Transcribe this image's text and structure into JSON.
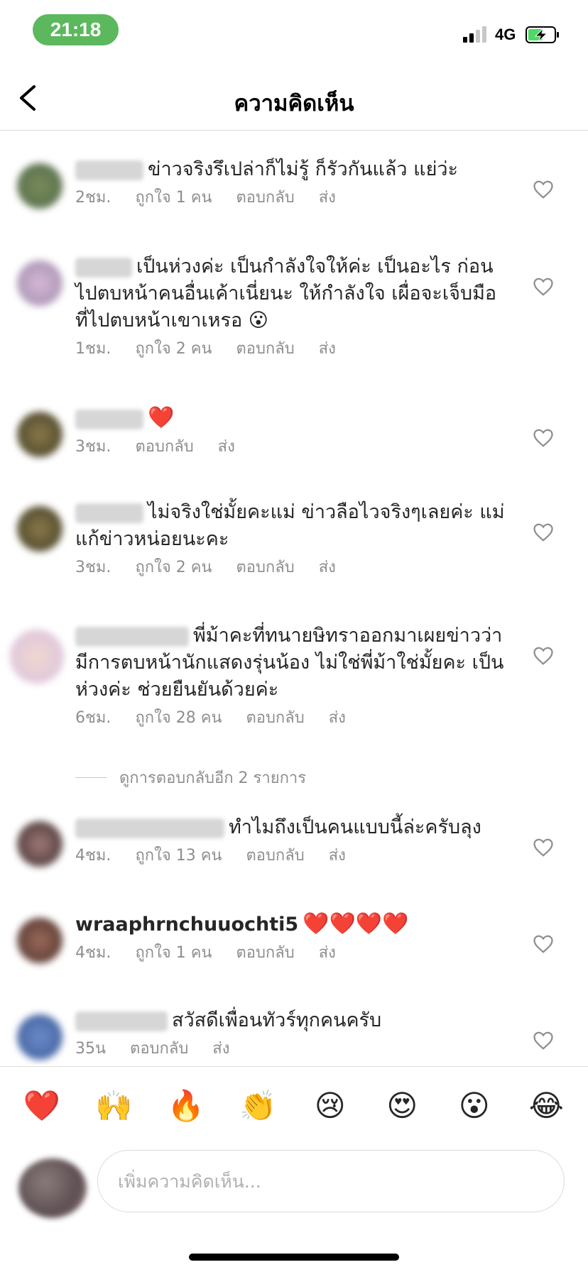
{
  "status_bar": {
    "time": "21:18",
    "network": "4G",
    "time_pill_color": "#5cb85c"
  },
  "header": {
    "title": "ความคิดเห็น",
    "back_icon": "chevron-left-icon"
  },
  "comments": [
    {
      "text": "ข่าวจริงรึเปล่าก็ไม่รู้ ก็รัวกันแล้ว แย่ว่ะ",
      "time": "2ชม.",
      "likes": "ถูกใจ 1 คน",
      "reply": "ตอบกลับ",
      "send": "ส่ง"
    },
    {
      "text": "เป็นห่วงค่ะ เป็นกำลังใจให้ค่ะ เป็นอะไร ก่อนไปตบหน้าคนอื่นเค้าเนี่ยนะ ให้กำลังใจ เผื่อจะเจ็บมือที่ไปตบหน้าเขาเหรอ 😮",
      "time": "1ชม.",
      "likes": "ถูกใจ 2 คน",
      "reply": "ตอบกลับ",
      "send": "ส่ง"
    },
    {
      "text": "❤️",
      "time": "3ชม.",
      "reply": "ตอบกลับ",
      "send": "ส่ง"
    },
    {
      "text": "ไม่จริงใช่มั้ยคะแม่ ข่าวลือไวจริงๆเลยค่ะ แม่แก้ข่าวหน่อยนะคะ",
      "time": "3ชม.",
      "likes": "ถูกใจ 2 คน",
      "reply": "ตอบกลับ",
      "send": "ส่ง"
    },
    {
      "text": "พี่ม้าคะที่ทนายษิทราออกมาเผยข่าวว่ามีการตบหน้านักแสดงรุ่นน้อง ไม่ใช่พี่ม้าใช่มั้ยคะ เป็นห่วงค่ะ ช่วยยืนยันด้วยค่ะ",
      "time": "6ชม.",
      "likes": "ถูกใจ 28 คน",
      "reply": "ตอบกลับ",
      "send": "ส่ง",
      "view_replies": "ดูการตอบกลับอีก 2 รายการ"
    },
    {
      "text": "ทำไมถึงเป็นคนแบบนี้ล่ะครับลุง",
      "time": "4ชม.",
      "likes": "ถูกใจ 13 คน",
      "reply": "ตอบกลับ",
      "send": "ส่ง"
    },
    {
      "username": "wraaphrnchuuochti5",
      "text": "❤️❤️❤️❤️",
      "time": "4ชม.",
      "likes": "ถูกใจ 1 คน",
      "reply": "ตอบกลับ",
      "send": "ส่ง"
    },
    {
      "text": "สวัสดีเพื่อนทัวร์ทุกคนครับ",
      "time": "35น",
      "reply": "ตอบกลับ",
      "send": "ส่ง"
    }
  ],
  "emoji_bar": [
    "❤️",
    "🙌",
    "🔥",
    "👏",
    "😢",
    "😍",
    "😮",
    "😂"
  ],
  "composer": {
    "placeholder": "เพิ่มความคิดเห็น..."
  },
  "colors": {
    "like_heart": "#ed4956",
    "meta_text": "#8e8e8e",
    "divider": "#dbdbdb"
  }
}
